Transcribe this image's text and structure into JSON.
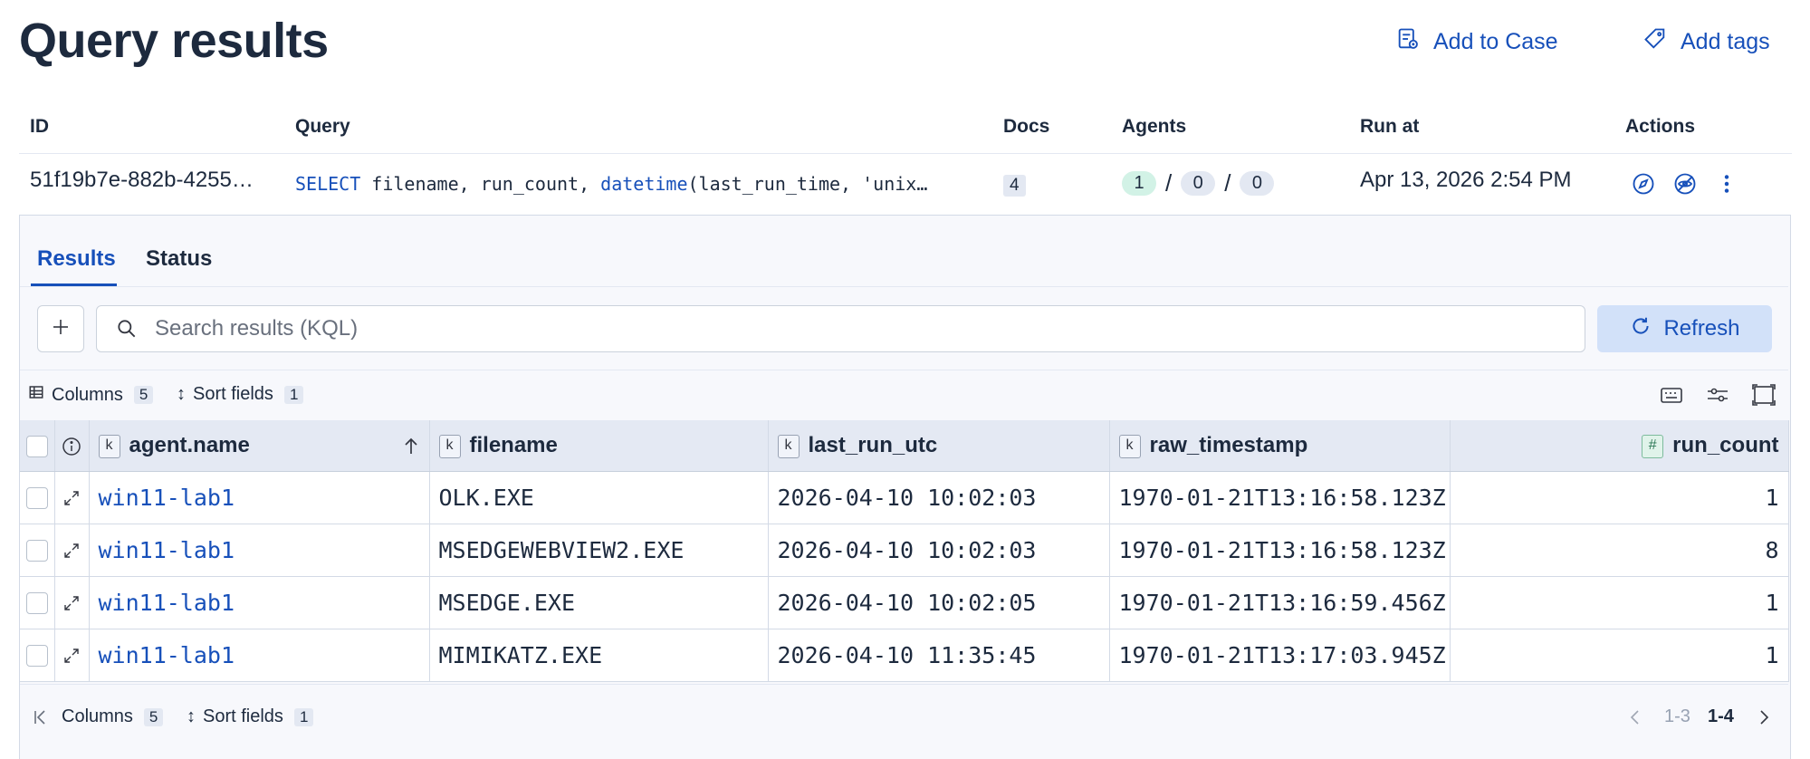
{
  "header": {
    "title": "Query results",
    "add_to_case": "Add to Case",
    "add_tags": "Add tags"
  },
  "summary": {
    "columns": [
      "ID",
      "Query",
      "Docs",
      "Agents",
      "Run at",
      "Actions"
    ],
    "row": {
      "id": "51f19b7e-882b-4255…",
      "query_keyword_1": "SELECT",
      "query_part_1": " filename, run_count, ",
      "query_keyword_2": "datetime",
      "query_part_2": "(last_run_time, 'unix…",
      "docs": "4",
      "agents_success": "1",
      "agents_pending": "0",
      "agents_failed": "0",
      "agents_sep": "/",
      "run_at": "Apr 13, 2026 2:54 PM"
    },
    "action_icons": [
      "compass-icon",
      "eye-off-icon",
      "more-vertical-icon"
    ]
  },
  "panel": {
    "tabs": [
      {
        "label": "Results",
        "active": true
      },
      {
        "label": "Status",
        "active": false
      }
    ],
    "search_placeholder": "Search results (KQL)",
    "refresh_label": "Refresh",
    "toolbar": {
      "columns_label": "Columns",
      "columns_count": "5",
      "sort_label": "Sort fields",
      "sort_count": "1"
    }
  },
  "grid": {
    "columns": [
      {
        "type": "k",
        "name": "agent.name",
        "sorted": "asc"
      },
      {
        "type": "k",
        "name": "filename"
      },
      {
        "type": "k",
        "name": "last_run_utc"
      },
      {
        "type": "k",
        "name": "raw_timestamp"
      },
      {
        "type": "#",
        "name": "run_count"
      }
    ],
    "rows": [
      [
        "win11-lab1",
        "OLK.EXE",
        "2026-04-10 10:02:03",
        "1970-01-21T13:16:58.123Z",
        "1"
      ],
      [
        "win11-lab1",
        "MSEDGEWEBVIEW2.EXE",
        "2026-04-10 10:02:03",
        "1970-01-21T13:16:58.123Z",
        "8"
      ],
      [
        "win11-lab1",
        "MSEDGE.EXE",
        "2026-04-10 10:02:05",
        "1970-01-21T13:16:59.456Z",
        "1"
      ],
      [
        "win11-lab1",
        "MIMIKATZ.EXE",
        "2026-04-10 11:35:45",
        "1970-01-21T13:17:03.945Z",
        "1"
      ]
    ]
  },
  "footer": {
    "columns_label": "Columns",
    "columns_count": "5",
    "sort_label": "Sort fields",
    "sort_count": "1",
    "page_prev_range": "1-3",
    "page_current_range": "1-4"
  },
  "colors": {
    "accent": "#1750ba",
    "header_bg": "#e4e9f3",
    "success_pill": "#d2f2e6"
  }
}
